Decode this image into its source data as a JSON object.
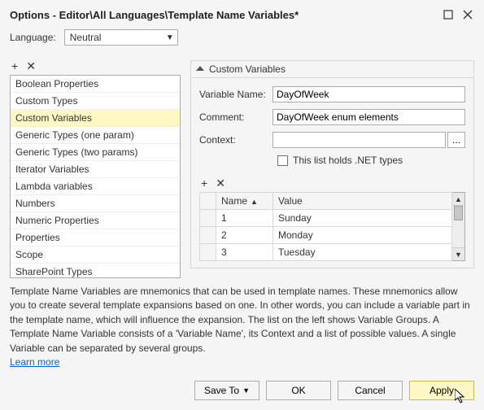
{
  "title": "Options - Editor\\All Languages\\Template Name Variables*",
  "language_label": "Language:",
  "language_value": "Neutral",
  "left_items": [
    "Boolean Properties",
    "Custom Types",
    "Custom Variables",
    "Generic Types (one param)",
    "Generic Types (two params)",
    "Iterator Variables",
    "Lambda variables",
    "Numbers",
    "Numeric Properties",
    "Properties",
    "Scope",
    "SharePoint Types"
  ],
  "selected_index": 2,
  "section_title": "Custom Variables",
  "form": {
    "var_name_label": "Variable Name:",
    "var_name_value": "DayOfWeek",
    "comment_label": "Comment:",
    "comment_value": "DayOfWeek enum elements",
    "context_label": "Context:",
    "context_value": "",
    "context_btn": "...",
    "checkbox_label": "This list holds .NET types"
  },
  "grid": {
    "headers": {
      "name": "Name",
      "value": "Value"
    },
    "rows": [
      {
        "n": "1",
        "value": "Sunday"
      },
      {
        "n": "2",
        "value": "Monday"
      },
      {
        "n": "3",
        "value": "Tuesday"
      }
    ]
  },
  "description": "Template Name Variables are mnemonics that can be used in template names. These mnemonics allow you to create several template expansions based on one. In other words, you can include a variable part in the template name, which will influence the expansion. The list on the left shows Variable Groups. A Template Name Variable consists of a 'Variable Name', its Context and a list of possible values. A single Variable can be separated by several groups.",
  "learn_more": "Learn more",
  "buttons": {
    "saveto": "Save To",
    "ok": "OK",
    "cancel": "Cancel",
    "apply": "Apply"
  }
}
